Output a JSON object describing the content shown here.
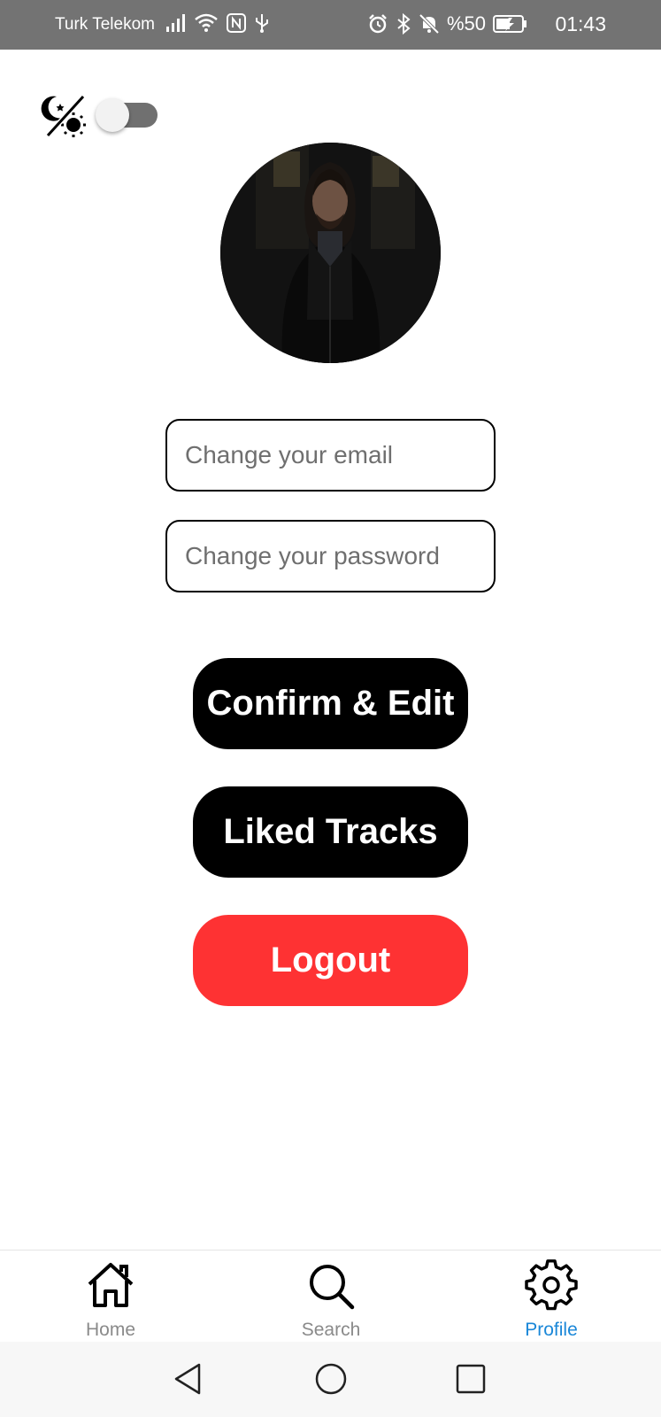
{
  "status_bar": {
    "carrier": "Turk Telekom",
    "battery": "%50",
    "time": "01:43",
    "icons_left": [
      "signal-icon",
      "wifi-icon",
      "nfc-icon",
      "usb-icon"
    ],
    "icons_right": [
      "alarm-icon",
      "bluetooth-icon",
      "mute-icon",
      "battery-charging-icon"
    ]
  },
  "theme_toggle": {
    "icon": "theme-moon-sun-icon",
    "state": "off"
  },
  "profile": {
    "avatar": "profile-photo"
  },
  "form": {
    "email_placeholder": "Change your email",
    "password_placeholder": "Change your password"
  },
  "actions": {
    "confirm_label": "Confirm & Edit",
    "liked_label": "Liked Tracks",
    "logout_label": "Logout"
  },
  "tabs": [
    {
      "label": "Home",
      "icon": "home-icon",
      "active": false
    },
    {
      "label": "Search",
      "icon": "search-icon",
      "active": false
    },
    {
      "label": "Profile",
      "icon": "gear-icon",
      "active": true
    }
  ],
  "colors": {
    "status_bar": "#737373",
    "logout": "#fe3233",
    "active_tab": "#1a87d8",
    "button": "#000000"
  }
}
